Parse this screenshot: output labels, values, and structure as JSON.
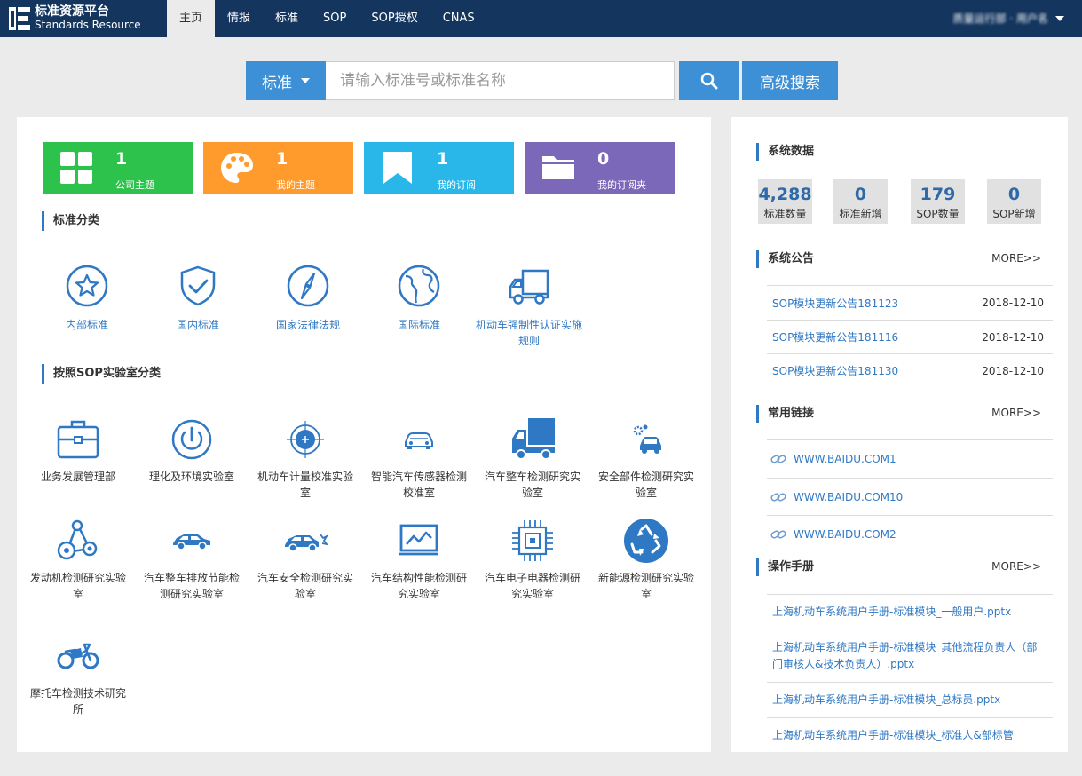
{
  "brand": {
    "name_cn": "标准资源平台",
    "name_en": "Standards Resource"
  },
  "nav": {
    "items": [
      {
        "label": "主页",
        "active": true
      },
      {
        "label": "情报",
        "active": false
      },
      {
        "label": "标准",
        "active": false
      },
      {
        "label": "SOP",
        "active": false
      },
      {
        "label": "SOP授权",
        "active": false
      },
      {
        "label": "CNAS",
        "active": false
      }
    ],
    "user_name": "质量运行部 · 用户名"
  },
  "search": {
    "type_label": "标准",
    "placeholder": "请输入标准号或标准名称",
    "value": "",
    "advanced_label": "高级搜索"
  },
  "tiles": [
    {
      "count": "1",
      "label": "公司主题",
      "color": "#2dc24b",
      "icon": "grid-icon"
    },
    {
      "count": "1",
      "label": "我的主题",
      "color": "#ff9a2c",
      "icon": "palette-icon"
    },
    {
      "count": "1",
      "label": "我的订阅",
      "color": "#28b7e8",
      "icon": "bookmark-icon"
    },
    {
      "count": "0",
      "label": "我的订阅夹",
      "color": "#7b68b8",
      "icon": "folder-icon"
    }
  ],
  "categories": {
    "title": "标准分类",
    "items": [
      {
        "label": "内部标准",
        "icon": "star-circle-icon"
      },
      {
        "label": "国内标准",
        "icon": "shield-check-icon"
      },
      {
        "label": "国家法律法规",
        "icon": "compass-icon"
      },
      {
        "label": "国际标准",
        "icon": "globe-icon"
      },
      {
        "label": "机动车强制性认证实施规则",
        "icon": "truck-outline-icon"
      }
    ]
  },
  "labs": {
    "title": "按照SOP实验室分类",
    "items": [
      {
        "label": "业务发展管理部",
        "icon": "briefcase-icon"
      },
      {
        "label": "理化及环境实验室",
        "icon": "power-gauge-icon"
      },
      {
        "label": "机动车计量校准实验室",
        "icon": "target-icon"
      },
      {
        "label": "智能汽车传感器检测校准室",
        "icon": "car-sensor-icon"
      },
      {
        "label": "汽车整车检测研究实验室",
        "icon": "truck-icon"
      },
      {
        "label": "安全部件检测研究实验室",
        "icon": "car-parts-icon"
      },
      {
        "label": "发动机检测研究实验室",
        "icon": "engine-belt-icon"
      },
      {
        "label": "汽车整车排放节能检测研究实验室",
        "icon": "car-emission-icon"
      },
      {
        "label": "汽车安全检测研究实验室",
        "icon": "car-crash-icon"
      },
      {
        "label": "汽车结构性能检测研究实验室",
        "icon": "monitor-chart-icon"
      },
      {
        "label": "汽车电子电器检测研究实验室",
        "icon": "chip-icon"
      },
      {
        "label": "新能源检测研究实验室",
        "icon": "recycle-icon"
      },
      {
        "label": "摩托车检测技术研究所",
        "icon": "motorcycle-icon"
      }
    ]
  },
  "stats": {
    "title": "系统数据",
    "items": [
      {
        "value": "4,288",
        "label": "标准数量"
      },
      {
        "value": "0",
        "label": "标准新增"
      },
      {
        "value": "179",
        "label": "SOP数量"
      },
      {
        "value": "0",
        "label": "SOP新增"
      }
    ]
  },
  "notices": {
    "title": "系统公告",
    "more": "MORE>>",
    "items": [
      {
        "title": "SOP模块更新公告181123",
        "date": "2018-12-10"
      },
      {
        "title": "SOP模块更新公告181116",
        "date": "2018-12-10"
      },
      {
        "title": "SOP模块更新公告181130",
        "date": "2018-12-10"
      }
    ]
  },
  "links": {
    "title": "常用链接",
    "more": "MORE>>",
    "items": [
      {
        "label": "WWW.BAIDU.COM1"
      },
      {
        "label": "WWW.BAIDU.COM10"
      },
      {
        "label": "WWW.BAIDU.COM2"
      }
    ]
  },
  "manuals": {
    "title": "操作手册",
    "more": "MORE>>",
    "items": [
      {
        "label": "上海机动车系统用户手册-标准模块_一般用户.pptx"
      },
      {
        "label": "上海机动车系统用户手册-标准模块_其他流程负责人（部门审核人&技术负责人）.pptx"
      },
      {
        "label": "上海机动车系统用户手册-标准模块_总标员.pptx"
      },
      {
        "label": "上海机动车系统用户手册-标准模块_标准人&部标管"
      }
    ]
  }
}
